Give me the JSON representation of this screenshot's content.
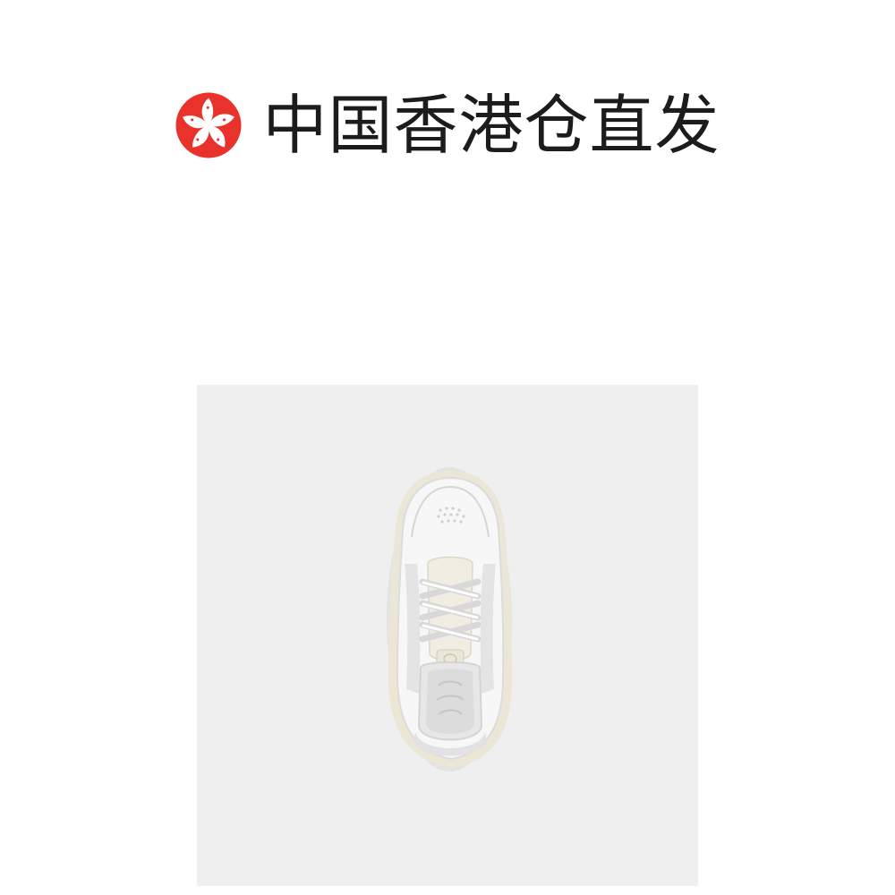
{
  "banner": {
    "icon": "hong-kong-bauhinia-flag-icon",
    "text": "中国香港仓直发",
    "icon_color": "#e8322b"
  },
  "product_image": {
    "subject": "white-low-top-sneaker-top-view",
    "background_color": "#efefef"
  }
}
